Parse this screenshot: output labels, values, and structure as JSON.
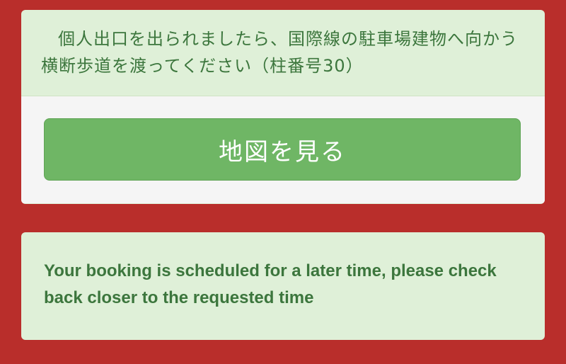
{
  "directions": {
    "instruction": "個人出口を出られましたら、国際線の駐車場建物へ向かう横断歩道を渡ってください（柱番号30）",
    "map_button_label": "地図を見る"
  },
  "booking_notice": {
    "message": "Your booking is scheduled for a later time, please check back closer to the requested time"
  },
  "colors": {
    "background": "#b92e2b",
    "panel": "#dff0d8",
    "text": "#3c763d",
    "button": "#6fb665"
  }
}
